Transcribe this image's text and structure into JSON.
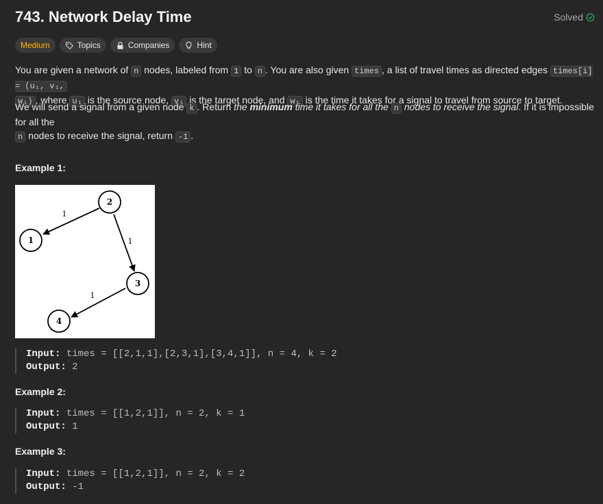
{
  "problem": {
    "title": "743. Network Delay Time",
    "status": "Solved"
  },
  "tags": {
    "difficulty": "Medium",
    "topics": "Topics",
    "companies": "Companies",
    "hint": "Hint"
  },
  "description": {
    "p1": {
      "t1": "You are given a network of ",
      "c1": "n",
      "t2": " nodes, labeled from ",
      "c2": "1",
      "t3": " to ",
      "c3": "n",
      "t4": ". You are also given ",
      "c4": "times",
      "t5": ", a list of travel times as directed edges ",
      "c5": "times[i] = (u₁, v₁,",
      "c6": "w₁)",
      "t6": ", where ",
      "c7": "u₁",
      "t7": " is the source node, ",
      "c8": "v₁",
      "t8": " is the target node, and ",
      "c9": "w₁",
      "t9": " is the time it takes for a signal to travel from source to target."
    },
    "p2": {
      "t1": "We will send a signal from a given node ",
      "c1": "k",
      "t2": ". Return ",
      "i1": "the ",
      "b1": "minimum",
      "i2": " time it takes for all the ",
      "c2": "n",
      "i3": " nodes to receive the signal",
      "t3": ". If it is impossible for all the",
      "c3": "n",
      "t4": " nodes to receive the signal, return ",
      "c4": "-1",
      "t5": "."
    }
  },
  "examples": [
    {
      "title": "Example 1:",
      "input_label": "Input:",
      "input_value": " times = [[2,1,1],[2,3,1],[3,4,1]], n = 4, k = 2",
      "output_label": "Output:",
      "output_value": " 2"
    },
    {
      "title": "Example 2:",
      "input_label": "Input:",
      "input_value": " times = [[1,2,1]], n = 2, k = 1",
      "output_label": "Output:",
      "output_value": " 1"
    },
    {
      "title": "Example 3:",
      "input_label": "Input:",
      "input_value": " times = [[1,2,1]], n = 2, k = 2",
      "output_label": "Output:",
      "output_value": " -1"
    }
  ],
  "graph": {
    "nodes": [
      "1",
      "2",
      "3",
      "4"
    ],
    "edge_weights": [
      "1",
      "1",
      "1"
    ]
  },
  "colors": {
    "background": "#262626",
    "difficulty_medium": "#ffb800",
    "solved_check": "#2cbb5d"
  },
  "icons": {
    "solved": "check-circle-icon",
    "topics": "tag-icon",
    "companies": "lock-icon",
    "hint": "lightbulb-icon"
  }
}
